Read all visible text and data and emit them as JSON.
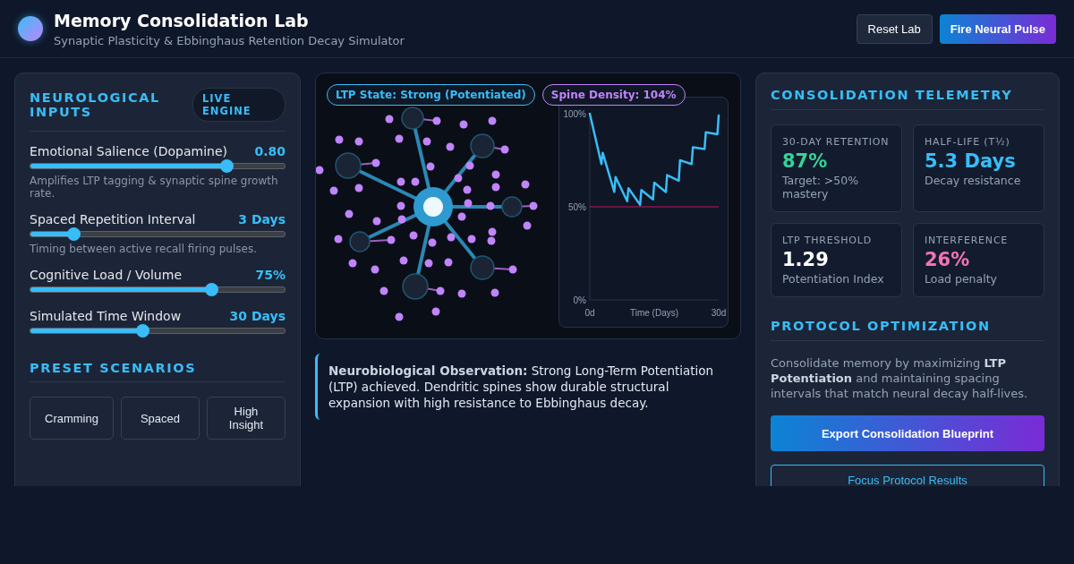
{
  "header": {
    "title": "Memory Consolidation Lab",
    "subtitle": "Synaptic Plasticity & Ebbinghaus Retention Decay Simulator",
    "buttons": [
      {
        "label": "Reset Lab",
        "kind": "secondary"
      },
      {
        "label": "Fire Neural Pulse",
        "kind": "primary"
      }
    ]
  },
  "inputs": {
    "title": "NEUROLOGICAL INPUTS",
    "badge": "LIVE ENGINE",
    "sliders": [
      {
        "label": "Emotional Salience (Dopamine)",
        "reading": "0.80",
        "level": 0.77,
        "hint": "Amplifies LTP tagging & synaptic spine growth rate."
      },
      {
        "label": "Spaced Repetition Interval",
        "reading": "3 Days",
        "level": 0.17,
        "hint": "Timing between active recall firing pulses."
      },
      {
        "label": "Cognitive Load / Volume",
        "reading": "75%",
        "level": 0.71
      },
      {
        "label": "Simulated Time Window",
        "reading": "30 Days",
        "level": 0.44
      }
    ],
    "presets_title": "PRESET SCENARIOS",
    "presets": [
      "Cramming",
      "Spaced",
      "High Insight"
    ]
  },
  "visual": {
    "badges": [
      {
        "label": "LTP State: Strong (Potentiated)",
        "color": "#38bdf8"
      },
      {
        "label": "Spine Density: 104%",
        "color": "#c084fc"
      }
    ],
    "chart_data": {
      "type": "line",
      "xlabel": "Time (Days)",
      "x": [
        0,
        2.7,
        3,
        5.7,
        6,
        8.7,
        9,
        11.7,
        12,
        14.7,
        15,
        17.7,
        18,
        20.7,
        21,
        23.7,
        24,
        26.7,
        27,
        29.7,
        30
      ],
      "series": [
        {
          "color": "#38bdf8",
          "values": [
            100,
            73,
            79,
            58,
            66,
            53,
            60,
            51,
            59,
            54,
            63,
            58,
            67,
            64,
            75,
            73,
            82,
            81,
            90,
            89,
            99
          ]
        }
      ],
      "xlim": [
        0,
        30
      ],
      "ylim": [
        0,
        100
      ],
      "xticks": [
        {
          "value": 0,
          "label": "0d"
        },
        {
          "value": 30,
          "label": "30d"
        }
      ],
      "yticks": [
        {
          "value": 0,
          "label": "0%"
        },
        {
          "value": 50,
          "label": "50%"
        },
        {
          "value": 100,
          "label": "100%"
        }
      ],
      "ref_lines": [
        {
          "axis": "y",
          "value": 50,
          "color": "#be185d"
        }
      ]
    },
    "observation": "**Neurobiological Observation:** Strong Long-Term Potentiation (LTP) achieved. Dendritic spines show durable structural expansion with high resistance to Ebbinghaus decay."
  },
  "telemetry": {
    "title": "CONSOLIDATION TELEMETRY",
    "metrics": [
      {
        "label": "30-DAY RETENTION",
        "value": "87%",
        "note": "Target: >50% mastery",
        "color": "#34d399"
      },
      {
        "label": "HALF-LIFE (T½)",
        "value": "5.3 Days",
        "note": "Decay resistance",
        "color": "#38bdf8"
      },
      {
        "label": "LTP THRESHOLD",
        "value": "1.29",
        "note": "Potentiation Index",
        "color": "#ffffff"
      },
      {
        "label": "INTERFERENCE",
        "value": "26%",
        "note": "Load penalty",
        "color": "#f472b6"
      }
    ]
  },
  "protocol": {
    "title": "PROTOCOL OPTIMIZATION",
    "text": "Consolidate memory by maximizing **LTP Potentiation** and maintaining spacing intervals that match neural decay half-lives.",
    "buttons": [
      {
        "label": "Export Consolidation Blueprint",
        "kind": "primary"
      },
      {
        "label": "Focus Protocol Results",
        "kind": "outline"
      }
    ]
  }
}
